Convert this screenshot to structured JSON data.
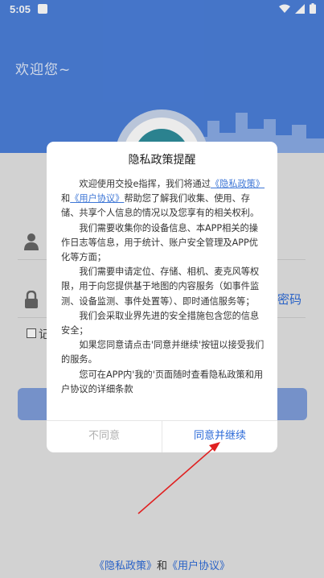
{
  "status_bar": {
    "time": "5:05"
  },
  "welcome_text": "欢迎您~",
  "login": {
    "forgot_password": "密码",
    "remember_label": "记"
  },
  "dialog": {
    "title": "隐私政策提醒",
    "paragraphs": {
      "p1_prefix": "欢迎使用交投e指挥，我们将通过",
      "p1_link1": "《隐私政策》",
      "p1_mid": "和",
      "p1_link2": "《用户协议》",
      "p1_suffix": "帮助您了解我们收集、使用、存储、共享个人信息的情况以及您享有的相关权利。",
      "p2": "我们需要收集你的设备信息、本APP相关的操作日志等信息，用于统计、账户安全管理及APP优化等方面；",
      "p3": "我们需要申请定位、存储、相机、麦克风等权限，用于向您提供基于地图的内容服务（如事件监测、设备监测、事件处置等）、即时通信服务等；",
      "p4": "我们会采取业界先进的安全措施包含您的信息安全；",
      "p5": "如果您同意请点击'同意并继续'按钮以接受我们的服务。",
      "p6": "您可在APP内'我的'页面随时查看隐私政策和用户协议的详细条款"
    },
    "disagree_label": "不同意",
    "agree_label": "同意并继续"
  },
  "footer": {
    "privacy_link": "《隐私政策》",
    "and": "和",
    "agreement_link": "《用户协议》"
  },
  "colors": {
    "header_blue": "#4b7fda",
    "link_blue": "#2d6bd8",
    "annotation_red": "#e02020"
  }
}
